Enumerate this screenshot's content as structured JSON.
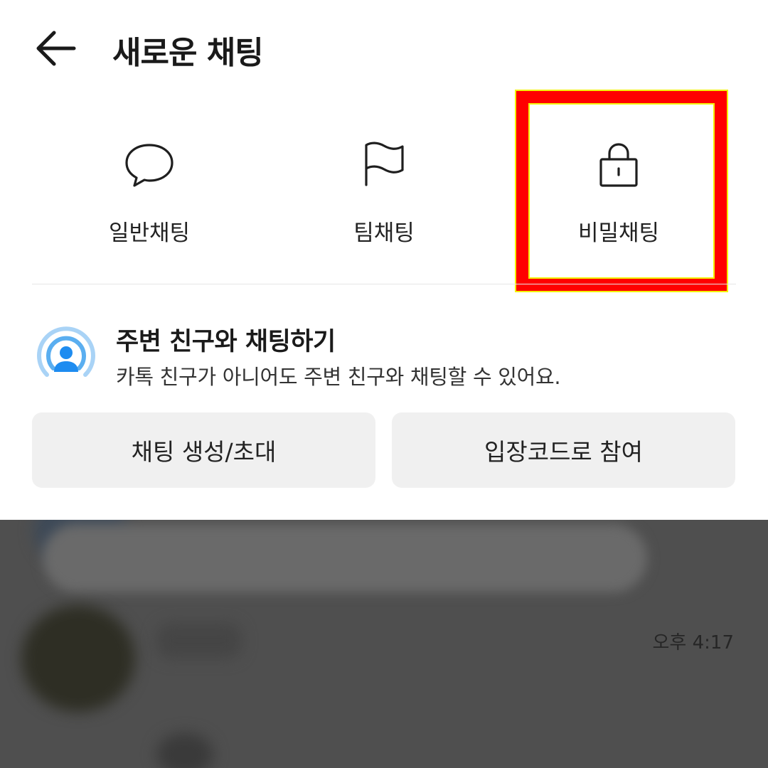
{
  "header": {
    "title": "새로운 채팅"
  },
  "chat_types": [
    {
      "label": "일반채팅",
      "icon": "speech-bubble-icon"
    },
    {
      "label": "팀채팅",
      "icon": "flag-icon"
    },
    {
      "label": "비밀채팅",
      "icon": "lock-icon"
    }
  ],
  "nearby": {
    "title": "주변 친구와 채팅하기",
    "description": "카톡 친구가 아니어도 주변 친구와 채팅할 수 있어요.",
    "icon": "nearby-friend-broadcast-icon"
  },
  "actions": {
    "create_label": "채팅 생성/초대",
    "join_label": "입장코드로 참여"
  },
  "background_list": {
    "time": "오후 4:17"
  },
  "colors": {
    "highlight": "#ff0000",
    "highlight_outline": "#f2f200",
    "accent_blue": "#1e8cf0",
    "dim_overlay": "#4f4f4f"
  }
}
